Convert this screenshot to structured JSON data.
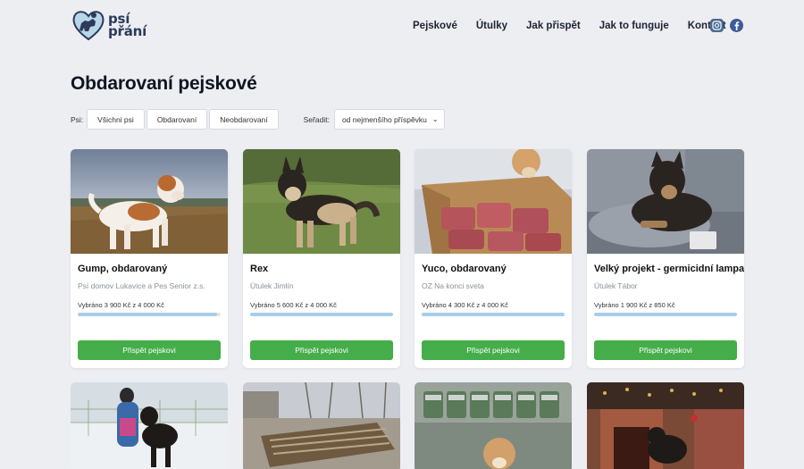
{
  "brand": {
    "line1": "psí",
    "line2": "přání"
  },
  "nav": [
    "Pejskové",
    "Útulky",
    "Jak přispět",
    "Jak to funguje",
    "Kontakt"
  ],
  "social": [
    "instagram-icon",
    "facebook-icon"
  ],
  "page_title": "Obdarovaní pejskové",
  "filters": {
    "label": "Psi:",
    "options": [
      "Všichni psi",
      "Obdarovaní",
      "Neobdarovaní"
    ],
    "sort_label": "Seřadit:",
    "sort_value": "od nejmenšího příspěvku"
  },
  "cards": [
    {
      "title": "Gump, obdarovaný",
      "shelter": "Psí domov Lukavice a Pes Senior z.s.",
      "progress": "Vybráno 3 900 Kč z 4 000 Kč",
      "pct": 0.975,
      "button": "Přispět pejskovi"
    },
    {
      "title": "Rex",
      "shelter": "Útulek Jimlín",
      "progress": "Vybráno 5 600 Kč z 4 000 Kč",
      "pct": 1.0,
      "button": "Přispět pejskovi"
    },
    {
      "title": "Yuco, obdarovaný",
      "shelter": "OZ Na konci sveta",
      "progress": "Vybráno 4 300 Kč z 4 000 Kč",
      "pct": 1.0,
      "button": "Přispět pejskovi"
    },
    {
      "title": "Velký projekt - germicidní lampa",
      "shelter": "Útulek Tábor",
      "progress": "Vybráno 1 900 Kč z 850 Kč",
      "pct": 1.0,
      "button": "Přispět pejskovi"
    }
  ],
  "colors": {
    "accent_green": "#45ad49",
    "progress_blue": "#a8cdea",
    "background": "#eceef2"
  }
}
